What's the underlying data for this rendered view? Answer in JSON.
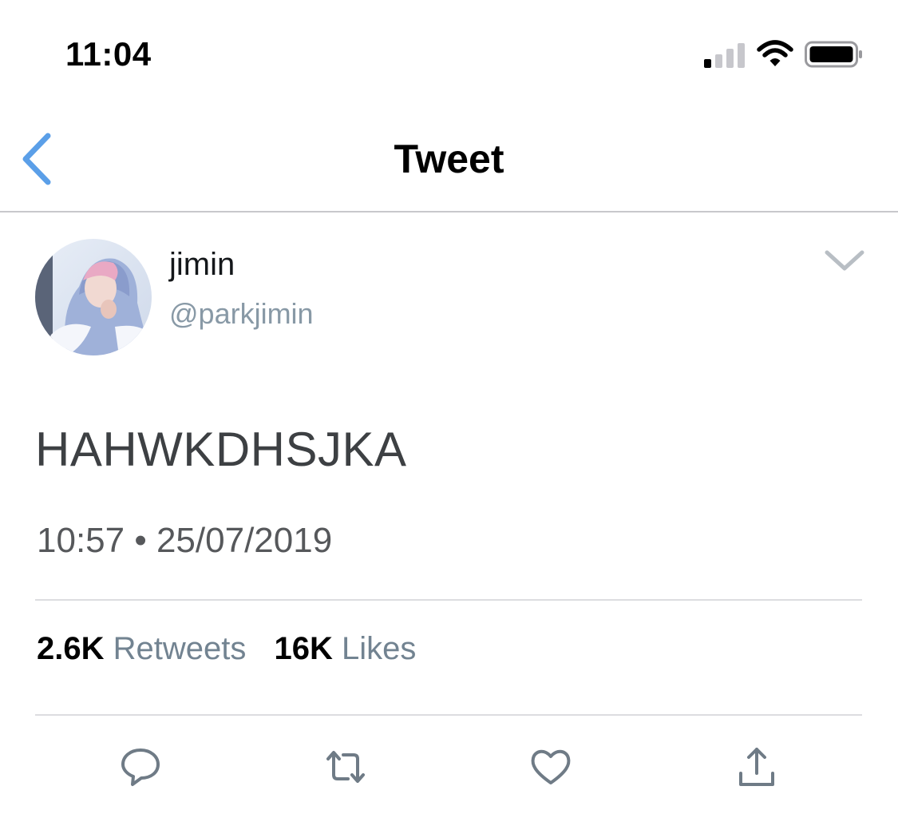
{
  "status_bar": {
    "time": "11:04",
    "icons": [
      "cellular-signal-icon",
      "wifi-icon",
      "battery-icon"
    ]
  },
  "nav": {
    "title": "Tweet",
    "back_icon": "chevron-left-icon"
  },
  "tweet": {
    "display_name": "jimin",
    "handle": "@parkjimin",
    "text": "HAHWKDHSJKA",
    "timestamp": "10:57 • 25/07/2019",
    "menu_icon": "chevron-down-icon",
    "stats": {
      "retweets_count": "2.6K",
      "retweets_label": "Retweets",
      "likes_count": "16K",
      "likes_label": "Likes"
    },
    "actions": [
      "reply-icon",
      "retweet-icon",
      "like-icon",
      "share-icon"
    ]
  },
  "colors": {
    "accent": "#5b9fe8",
    "text_primary": "#14171a",
    "text_secondary": "#8899a6",
    "divider": "#dcdde0"
  }
}
